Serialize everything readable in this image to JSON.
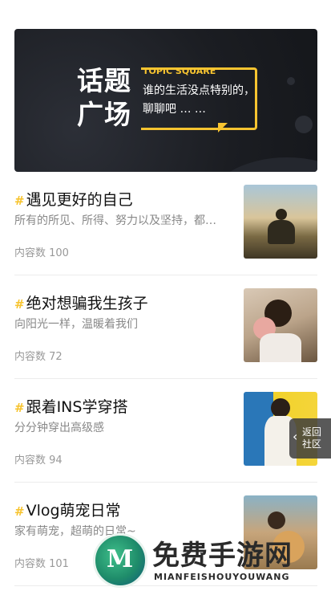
{
  "banner": {
    "title_big": "话题广场",
    "title_en": "TOPIC SQUARE",
    "subtitle": "谁的生活没点特别的，聊聊吧 … …"
  },
  "topics": [
    {
      "title": "遇见更好的自己",
      "desc": "所有的所见、所得、努力以及坚持，都…",
      "count": "内容数 100"
    },
    {
      "title": "绝对想骗我生孩子",
      "desc": "向阳光一样，温暖着我们",
      "count": "内容数 72"
    },
    {
      "title": "跟着INS学穿搭",
      "desc": "分分钟穿出高级感",
      "count": "内容数 94"
    },
    {
      "title": "Vlog萌宠日常",
      "desc": "家有萌宠，超萌的日常~",
      "count": "内容数 101"
    }
  ],
  "float_button": {
    "label": "返回社区"
  },
  "watermark": {
    "cn": "免费手游网",
    "en": "MIANFEISHOUYOUWANG"
  },
  "colors": {
    "accent": "#f7c430",
    "banner_bg": "#1b1d22"
  }
}
